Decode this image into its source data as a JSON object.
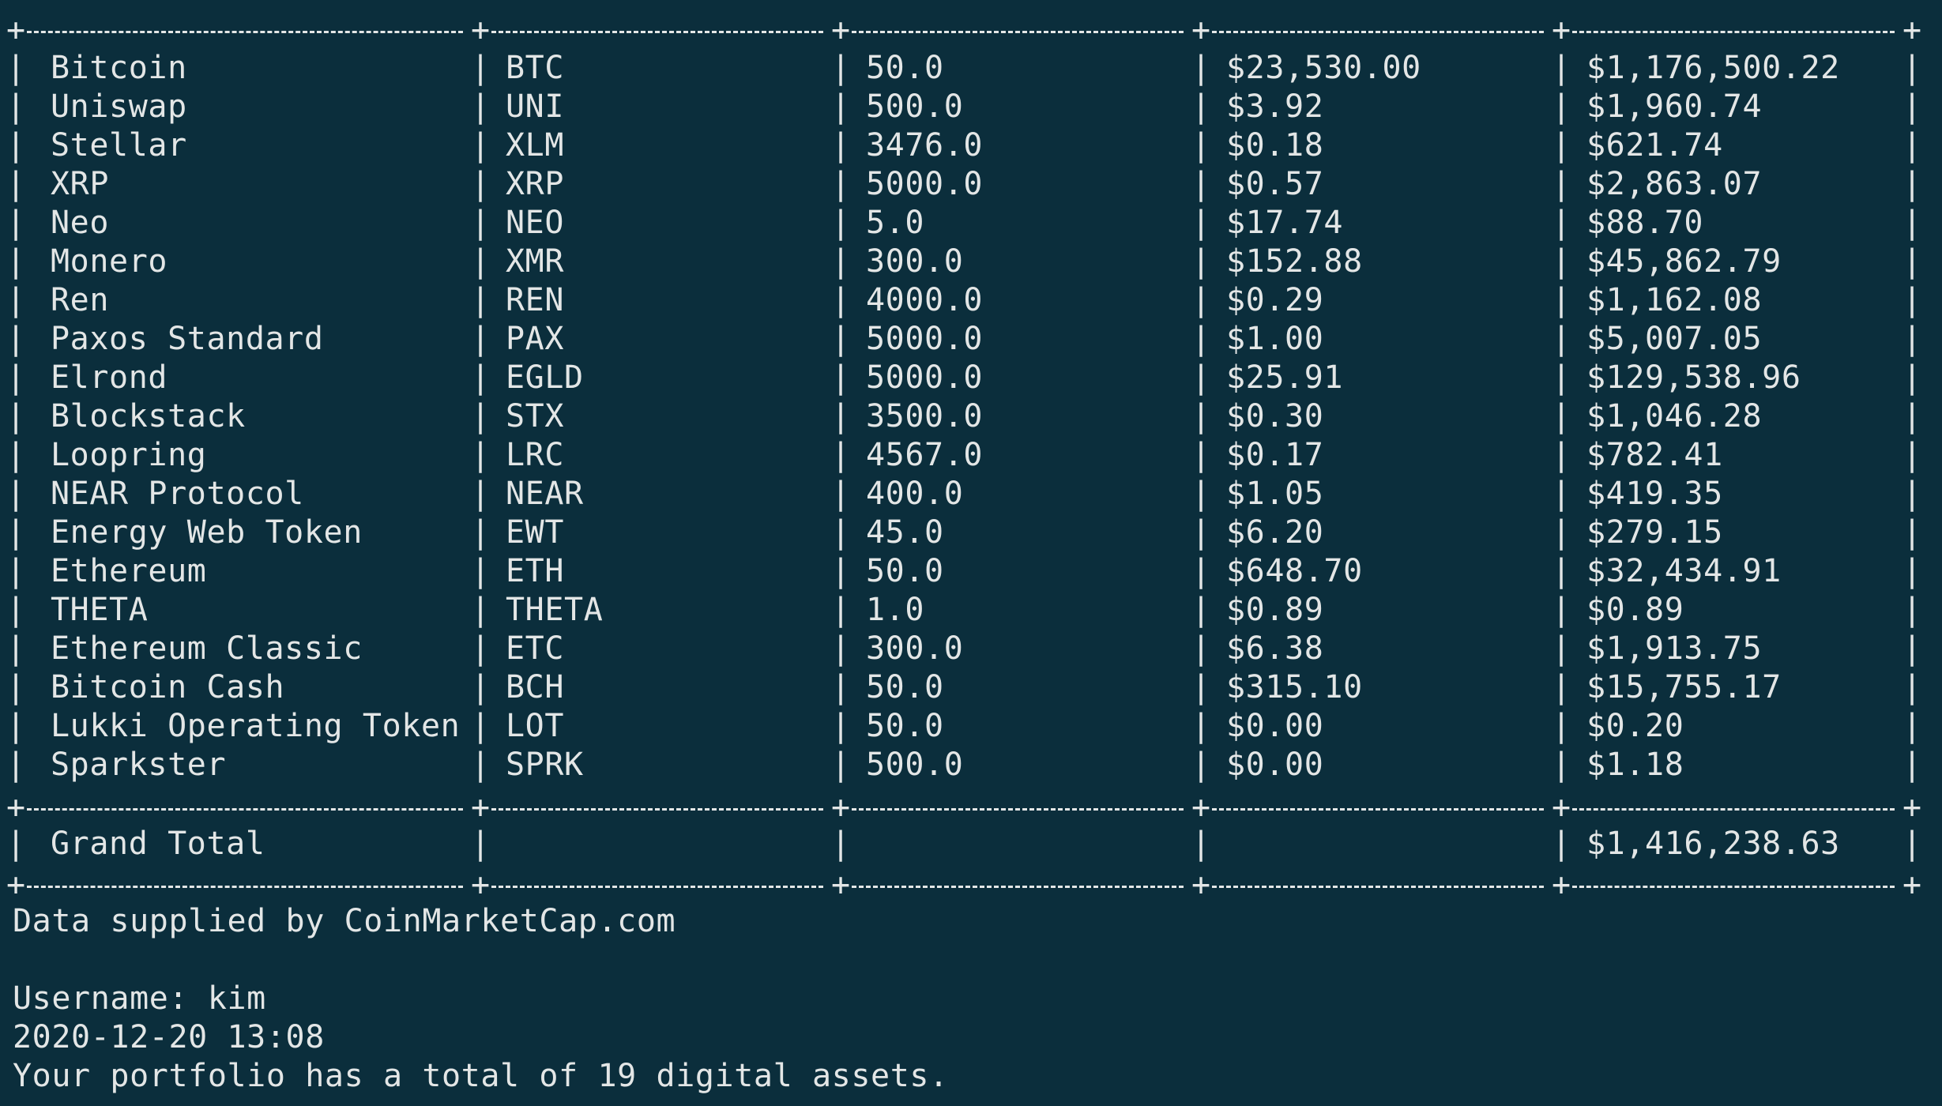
{
  "table": {
    "rows": [
      [
        "Bitcoin",
        "BTC",
        "50.0",
        "$23,530.00",
        "$1,176,500.22"
      ],
      [
        "Uniswap",
        "UNI",
        "500.0",
        "$3.92",
        "$1,960.74"
      ],
      [
        "Stellar",
        "XLM",
        "3476.0",
        "$0.18",
        "$621.74"
      ],
      [
        "XRP",
        "XRP",
        "5000.0",
        "$0.57",
        "$2,863.07"
      ],
      [
        "Neo",
        "NEO",
        "5.0",
        "$17.74",
        "$88.70"
      ],
      [
        "Monero",
        "XMR",
        "300.0",
        "$152.88",
        "$45,862.79"
      ],
      [
        "Ren",
        "REN",
        "4000.0",
        "$0.29",
        "$1,162.08"
      ],
      [
        "Paxos Standard",
        "PAX",
        "5000.0",
        "$1.00",
        "$5,007.05"
      ],
      [
        "Elrond",
        "EGLD",
        "5000.0",
        "$25.91",
        "$129,538.96"
      ],
      [
        "Blockstack",
        "STX",
        "3500.0",
        "$0.30",
        "$1,046.28"
      ],
      [
        "Loopring",
        "LRC",
        "4567.0",
        "$0.17",
        "$782.41"
      ],
      [
        "NEAR Protocol",
        "NEAR",
        "400.0",
        "$1.05",
        "$419.35"
      ],
      [
        "Energy Web Token",
        "EWT",
        "45.0",
        "$6.20",
        "$279.15"
      ],
      [
        "Ethereum",
        "ETH",
        "50.0",
        "$648.70",
        "$32,434.91"
      ],
      [
        "THETA",
        "THETA",
        "1.0",
        "$0.89",
        "$0.89"
      ],
      [
        "Ethereum Classic",
        "ETC",
        "300.0",
        "$6.38",
        "$1,913.75"
      ],
      [
        "Bitcoin Cash",
        "BCH",
        "50.0",
        "$315.10",
        "$15,755.17"
      ],
      [
        "Lukki Operating Token",
        "LOT",
        "50.0",
        "$0.00",
        "$0.20"
      ],
      [
        "Sparkster",
        "SPRK",
        "500.0",
        "$0.00",
        "$1.18"
      ]
    ],
    "total_label": "Grand Total",
    "total_value": "$1,416,238.63"
  },
  "footer": {
    "source": "Data supplied by CoinMarketCap.com",
    "username": "Username: kim",
    "timestamp": "2020-12-20 13:08",
    "summary": "Your portfolio has a total of 19 digital assets."
  },
  "colors": {
    "background": "#0b2e3c",
    "text": "#e3e6e6"
  }
}
